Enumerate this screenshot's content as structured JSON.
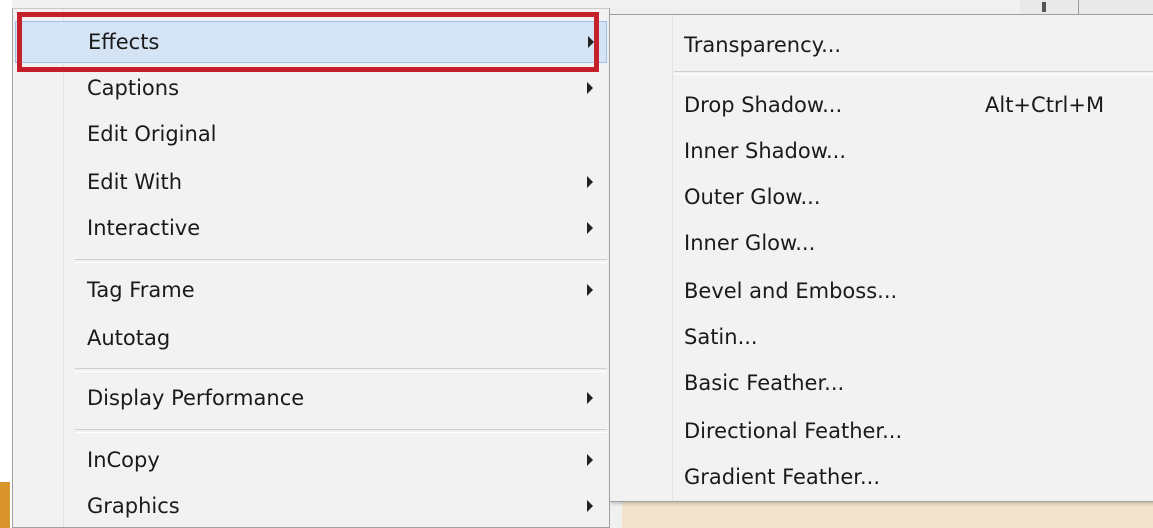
{
  "context_menu": {
    "items": [
      {
        "label": "Effects",
        "has_submenu": true,
        "selected": true
      },
      {
        "label": "Captions",
        "has_submenu": true
      },
      {
        "label": "Edit Original",
        "has_submenu": false
      },
      {
        "label": "Edit With",
        "has_submenu": true
      },
      {
        "label": "Interactive",
        "has_submenu": true
      },
      {
        "label": "Tag Frame",
        "has_submenu": true
      },
      {
        "label": "Autotag",
        "has_submenu": false
      },
      {
        "label": "Display Performance",
        "has_submenu": true
      },
      {
        "label": "InCopy",
        "has_submenu": true
      },
      {
        "label": "Graphics",
        "has_submenu": true
      }
    ]
  },
  "effects_submenu": {
    "items": [
      {
        "label": "Transparency...",
        "shortcut": ""
      },
      {
        "label": "Drop Shadow...",
        "shortcut": "Alt+Ctrl+M"
      },
      {
        "label": "Inner Shadow...",
        "shortcut": ""
      },
      {
        "label": "Outer Glow...",
        "shortcut": ""
      },
      {
        "label": "Inner Glow...",
        "shortcut": ""
      },
      {
        "label": "Bevel and Emboss...",
        "shortcut": ""
      },
      {
        "label": "Satin...",
        "shortcut": ""
      },
      {
        "label": "Basic Feather...",
        "shortcut": ""
      },
      {
        "label": "Directional Feather...",
        "shortcut": ""
      },
      {
        "label": "Gradient Feather...",
        "shortcut": ""
      }
    ]
  },
  "colors": {
    "selection_fill": "#d5e4f4",
    "highlight_box": "#c41f2b",
    "menu_background": "#f2f2f2"
  }
}
